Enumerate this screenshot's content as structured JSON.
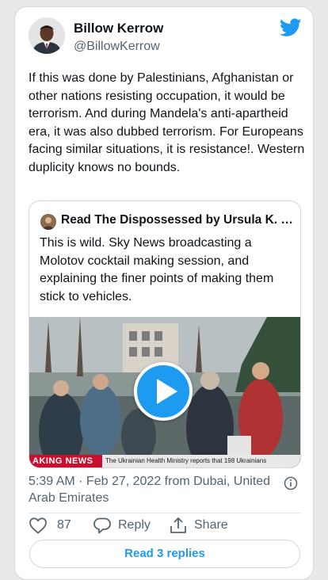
{
  "author": {
    "display_name": "Billow Kerrow",
    "handle": "@BillowKerrow"
  },
  "tweet": {
    "text": "If this was done by Palestinians,  Afghanistan or other nations resisting occupation, it would be terrorism. And during Mandela's anti-apartheid era, it was also dubbed terrorism. For Europeans facing similar situations, it is resistance!. Western duplicity knows no bounds.",
    "timestamp": "5:39 AM · Feb 27, 2022 from Dubai, United Arab Emirates"
  },
  "quote": {
    "author": "Read The Dispossessed by Ursula K. L...",
    "text": "This is wild. Sky News broadcasting a Molotov cocktail making session, and explaining the finer points of making them stick to vehicles.",
    "ribbon_left": "AKING NEWS",
    "ribbon_right": "The Ukrainian Health Ministry reports that 198 Ukrainians"
  },
  "actions": {
    "like_count": "87",
    "reply_label": "Reply",
    "share_label": "Share",
    "read_replies_label": "Read 3 replies"
  },
  "colors": {
    "accent": "#1d9bf0",
    "secondary_text": "#536471",
    "news_red": "#c8102e"
  },
  "icons": [
    "twitter-bird-icon",
    "play-icon",
    "info-icon",
    "heart-icon",
    "reply-bubble-icon",
    "share-icon"
  ]
}
